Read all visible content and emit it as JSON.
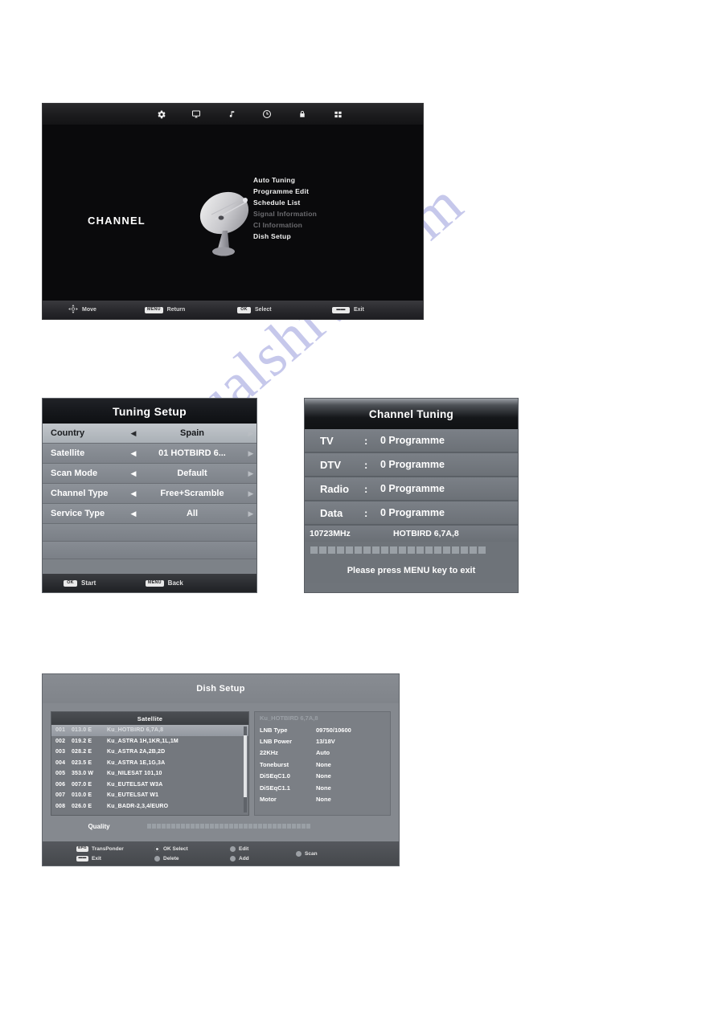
{
  "watermark": {
    "text": "manualshive.com"
  },
  "channel_menu_screen": {
    "name": "CHANNEL",
    "topbar_icons": [
      {
        "name": "gear-icon",
        "glyph": "gear"
      },
      {
        "name": "monitor-icon",
        "glyph": "monitor"
      },
      {
        "name": "music-note-icon",
        "glyph": "music"
      },
      {
        "name": "clock-icon",
        "glyph": "clock"
      },
      {
        "name": "lock-icon",
        "glyph": "lock"
      },
      {
        "name": "grid-icon",
        "glyph": "grid"
      }
    ],
    "menu_items": [
      {
        "label": "Auto Tuning",
        "disabled": false
      },
      {
        "label": "Programme Edit",
        "disabled": false
      },
      {
        "label": "Schedule List",
        "disabled": false
      },
      {
        "label": "Signal Information",
        "disabled": true
      },
      {
        "label": "CI Information",
        "disabled": true
      },
      {
        "label": "Dish Setup",
        "disabled": false
      }
    ],
    "footer": [
      {
        "key": "",
        "key_icon": "dpad",
        "label": "Move"
      },
      {
        "key": "MENU",
        "label": "Return"
      },
      {
        "key": "OK",
        "label": "Select"
      },
      {
        "key": "",
        "key_icon": "exit",
        "label": "Exit"
      }
    ]
  },
  "tuning_setup_screen": {
    "title": "Tuning Setup",
    "rows": [
      {
        "label": "Country",
        "value": "Spain",
        "selected": true
      },
      {
        "label": "Satellite",
        "value": "01 HOTBIRD 6...",
        "selected": false
      },
      {
        "label": "Scan Mode",
        "value": "Default",
        "selected": false
      },
      {
        "label": "Channel Type",
        "value": "Free+Scramble",
        "selected": false
      },
      {
        "label": "Service Type",
        "value": "All",
        "selected": false
      }
    ],
    "left_arrow": "◀",
    "right_arrow": "▶",
    "footer": [
      {
        "key": "OK",
        "label": "Start"
      },
      {
        "key": "MENU",
        "label": "Back"
      }
    ]
  },
  "channel_tuning_screen": {
    "title": "Channel Tuning",
    "rows": [
      {
        "label": "TV",
        "sep": ":",
        "value": "0 Programme"
      },
      {
        "label": "DTV",
        "sep": ":",
        "value": "0 Programme"
      },
      {
        "label": "Radio",
        "sep": ":",
        "value": "0 Programme"
      },
      {
        "label": "Data",
        "sep": ":",
        "value": "0 Programme"
      }
    ],
    "frequency": "10723MHz",
    "satellite": "HOTBIRD 6,7A,8",
    "progress_blocks": 20,
    "hint": "Please press MENU key to exit"
  },
  "dish_setup_screen": {
    "title": "Dish Setup",
    "satellite_column_header": "Satellite",
    "satellites": [
      {
        "no": "001",
        "pos": "013.0 E",
        "name": "Ku_HOTBIRD 6,7A,8",
        "selected": true
      },
      {
        "no": "002",
        "pos": "019.2 E",
        "name": "Ku_ASTRA 1H,1KR,1L,1M",
        "selected": false
      },
      {
        "no": "003",
        "pos": "028.2 E",
        "name": "Ku_ASTRA 2A,2B,2D",
        "selected": false
      },
      {
        "no": "004",
        "pos": "023.5 E",
        "name": "Ku_ASTRA 1E,1G,3A",
        "selected": false
      },
      {
        "no": "005",
        "pos": "353.0 W",
        "name": "Ku_NILESAT 101,10",
        "selected": false
      },
      {
        "no": "006",
        "pos": "007.0 E",
        "name": "Ku_EUTELSAT W3A",
        "selected": false
      },
      {
        "no": "007",
        "pos": "010.0 E",
        "name": "Ku_EUTELSAT W1",
        "selected": false
      },
      {
        "no": "008",
        "pos": "026.0 E",
        "name": "Ku_BADR-2,3,4/EURO",
        "selected": false
      }
    ],
    "detail_header": "Ku_HOTBIRD 6,7A,8",
    "detail_rows": [
      {
        "key": "LNB Type",
        "value": "09750/10600"
      },
      {
        "key": "LNB Power",
        "value": "13/18V"
      },
      {
        "key": "22KHz",
        "value": "Auto"
      },
      {
        "key": "Toneburst",
        "value": "None"
      },
      {
        "key": "DiSEqC1.0",
        "value": "None"
      },
      {
        "key": "DiSEqC1.1",
        "value": "None"
      },
      {
        "key": "Motor",
        "value": "None"
      }
    ],
    "quality_label": "Quality",
    "quality_blocks": 34,
    "footer": {
      "col1": [
        {
          "key": "EPG",
          "label": "TransPonder",
          "style": "keycap"
        },
        {
          "key": "",
          "label": "Exit",
          "style": "exitcap"
        }
      ],
      "col2": [
        {
          "label": "OK Select",
          "style": "ring"
        },
        {
          "label": "Delete",
          "style": "dot"
        }
      ],
      "col3": [
        {
          "label": "Edit",
          "style": "dot"
        },
        {
          "label": "Add",
          "style": "dot"
        }
      ],
      "col4": [
        {
          "label": "Scan",
          "style": "dot"
        }
      ]
    }
  }
}
